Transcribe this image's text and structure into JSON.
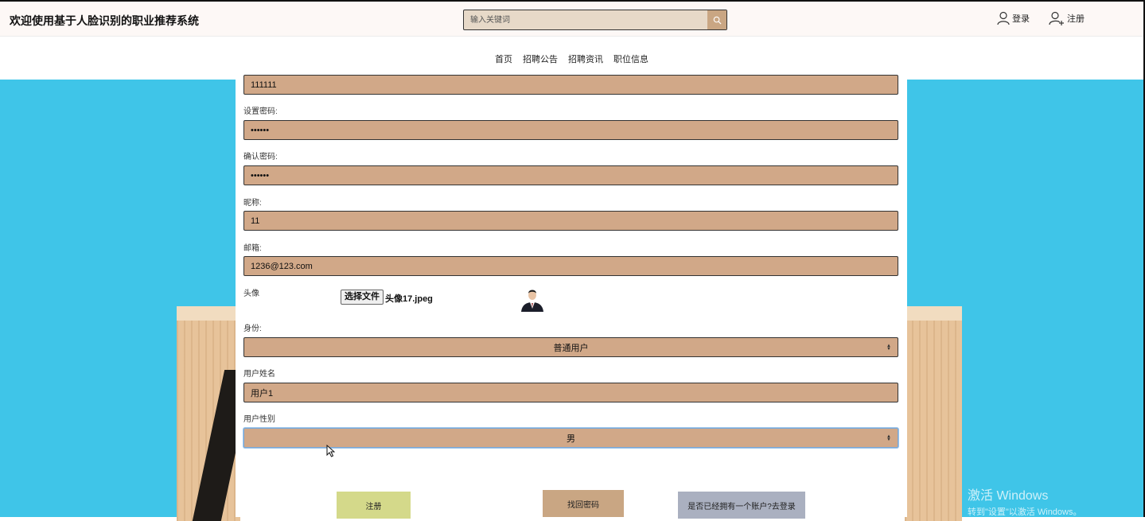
{
  "header": {
    "site_title": "欢迎使用基于人脸识别的职业推荐系统",
    "search_placeholder": "输入关键词",
    "login": "登录",
    "register": "注册"
  },
  "nav": {
    "items": [
      "首页",
      "招聘公告",
      "招聘资讯",
      "职位信息"
    ]
  },
  "form": {
    "account_value": "111111",
    "password_label": "设置密码:",
    "password_value": "••••••",
    "confirm_label": "确认密码:",
    "confirm_value": "••••••",
    "nickname_label": "昵称:",
    "nickname_value": "11",
    "email_label": "邮箱:",
    "email_value": "1236@123.com",
    "avatar_label": "头像",
    "file_button": "选择文件",
    "file_name": "头像17.jpeg",
    "role_label": "身份:",
    "role_value": "普通用户",
    "name_label": "用户姓名",
    "name_value": "用户1",
    "gender_label": "用户性别",
    "gender_value": "男"
  },
  "buttons": {
    "register": "注册",
    "forgot": "找回密码",
    "have_account": "是否已经拥有一个账户?去登录"
  },
  "watermark": {
    "line1": "激活 Windows",
    "line2": "转到\"设置\"以激活 Windows。"
  },
  "colors": {
    "field_bg": "#d1a888",
    "background": "#3fc5e8",
    "register_btn": "#d4d98a",
    "forgot_btn": "#c9a683",
    "login_btn": "#aab0c0"
  },
  "icons": [
    "search-icon",
    "user-icon",
    "user-plus-icon",
    "caret-icon",
    "mouse-cursor-icon"
  ]
}
